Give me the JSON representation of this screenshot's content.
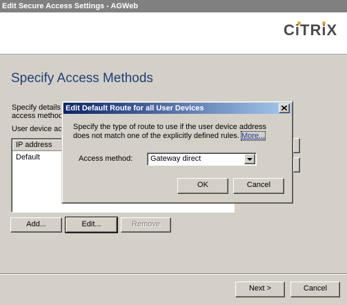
{
  "window": {
    "title": "Edit Secure Access Settings - AGWeb"
  },
  "brand": {
    "logo_text": "CiTRiX",
    "accent_color": "#e8a330",
    "title_color": "#1c3f78"
  },
  "page": {
    "title": "Specify Access Methods",
    "description_line1": "Specify details",
    "description_line2": "access method",
    "device_label": "User device ac"
  },
  "device_table": {
    "columns": [
      "IP address"
    ],
    "rows": [
      {
        "ip_address": "Default"
      }
    ]
  },
  "buttons": {
    "add": "Add...",
    "edit": "Edit...",
    "remove": "Remove",
    "next": "Next >",
    "cancel": "Cancel"
  },
  "dialog": {
    "title": "Edit Default Route for all User Devices",
    "close_icon": "close-icon",
    "text_line1": "Specify the type of route to use if the user device address",
    "text_line2": "does not match one of the explicitly defined rules.",
    "more_link": "More...",
    "access_label": "Access method:",
    "access_value": "Gateway direct",
    "ok": "OK",
    "cancel": "Cancel"
  }
}
